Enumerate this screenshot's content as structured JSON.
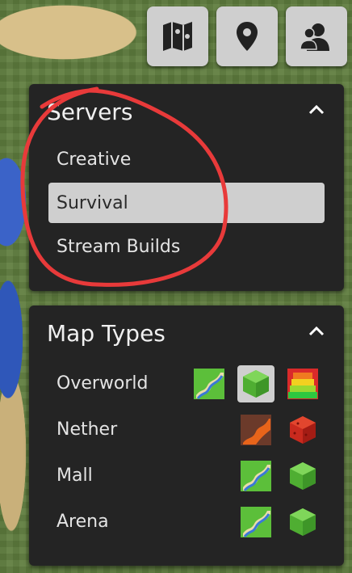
{
  "servers": {
    "title": "Servers",
    "items": [
      {
        "label": "Creative",
        "active": false
      },
      {
        "label": "Survival",
        "active": true
      },
      {
        "label": "Stream Builds",
        "active": false
      }
    ]
  },
  "map_types": {
    "title": "Map Types",
    "rows": [
      {
        "label": "Overworld",
        "icons": [
          "flat-map-icon",
          "3d-cube-icon",
          "heatmap-icon"
        ],
        "selected": "3d-cube-icon"
      },
      {
        "label": "Nether",
        "icons": [
          "nether-flat-map-icon",
          "nether-cube-icon"
        ]
      },
      {
        "label": "Mall",
        "icons": [
          "flat-map-icon",
          "3d-cube-icon"
        ]
      },
      {
        "label": "Arena",
        "icons": [
          "flat-map-icon",
          "3d-cube-icon"
        ]
      }
    ]
  },
  "toolbar": {
    "icons": [
      "map-icon",
      "location-pin-icon",
      "players-icon"
    ]
  },
  "colors": {
    "panel_bg": "#242424",
    "active_bg": "#cfcfcf",
    "annotation": "#e83a3a"
  }
}
